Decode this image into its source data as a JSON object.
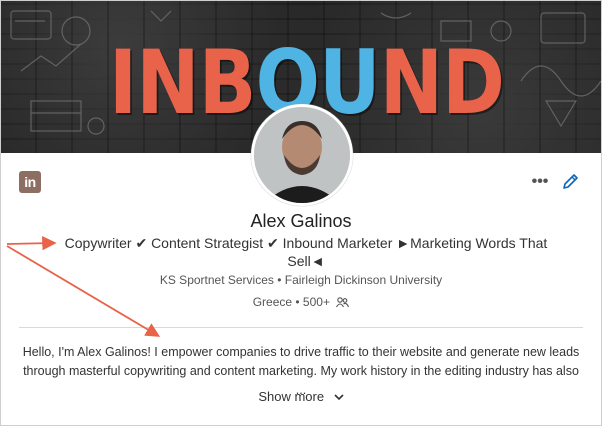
{
  "banner": {
    "letters": [
      {
        "char": "I",
        "color": "#e8634a"
      },
      {
        "char": "N",
        "color": "#e8634a"
      },
      {
        "char": "B",
        "color": "#e8634a"
      },
      {
        "char": "O",
        "color": "#4fb4e3"
      },
      {
        "char": "U",
        "color": "#4fb4e3"
      },
      {
        "char": "N",
        "color": "#e8634a"
      },
      {
        "char": "D",
        "color": "#e8634a"
      }
    ]
  },
  "profile": {
    "name": "Alex Galinos",
    "headline": "Copywriter ✔ Content Strategist ✔ Inbound Marketer ►Marketing Words That Sell◄",
    "company_school": "KS Sportnet Services • Fairleigh Dickinson University",
    "location_connections": "Greece • 500+"
  },
  "about": {
    "text": "Hello, I'm Alex Galinos! I empower companies to drive traffic to their website and generate new leads through masterful copywriting and content marketing. My work history in the editing industry has also ...",
    "show_more_label": "Show more"
  },
  "icons": {
    "linkedin": "linkedin-icon",
    "more": "more-options-icon",
    "edit": "pencil-icon",
    "connections": "people-icon",
    "chevron": "chevron-down-icon"
  },
  "colors": {
    "linkedin_badge": "#8d6e63",
    "edit_icon": "#0a66c2",
    "annotation_arrow": "#e8634a"
  },
  "linkedin_badge_text": "in",
  "more_glyph": "•••"
}
